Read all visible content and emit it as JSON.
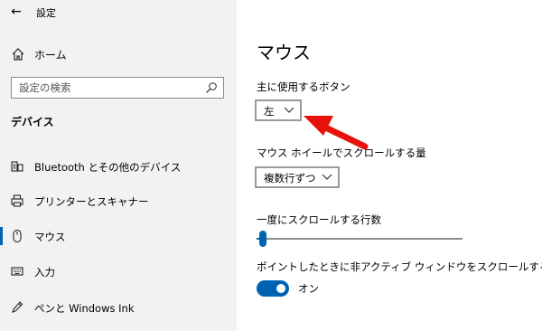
{
  "window": {
    "title": "設定",
    "back_icon": "back-arrow-icon"
  },
  "sidebar": {
    "home": {
      "label": "ホーム",
      "icon": "home-icon"
    },
    "search": {
      "placeholder": "設定の検索",
      "icon": "search-icon"
    },
    "section_title": "デバイス",
    "items": [
      {
        "label": "Bluetooth とその他のデバイス",
        "icon": "bluetooth-devices-icon",
        "active": false
      },
      {
        "label": "プリンターとスキャナー",
        "icon": "printer-icon",
        "active": false
      },
      {
        "label": "マウス",
        "icon": "mouse-icon",
        "active": true
      },
      {
        "label": "入力",
        "icon": "keyboard-icon",
        "active": false
      },
      {
        "label": "ペンと Windows Ink",
        "icon": "pen-icon",
        "active": false
      }
    ]
  },
  "main": {
    "title": "マウス",
    "primary_button": {
      "label": "主に使用するボタン",
      "value": "左"
    },
    "wheel_scroll": {
      "label": "マウス ホイールでスクロールする量",
      "value": "複数行ずつ"
    },
    "lines_scroll": {
      "label": "一度にスクロールする行数",
      "level_fraction": 0.03
    },
    "inactive_scroll": {
      "label": "ポイントしたときに非アクティブ ウィンドウをスクロールする",
      "state": "オン",
      "on": true
    }
  },
  "colors": {
    "accent": "#0063b1",
    "sidebar_bg": "#f2f2f2",
    "annotation_arrow": "#e8120c"
  }
}
